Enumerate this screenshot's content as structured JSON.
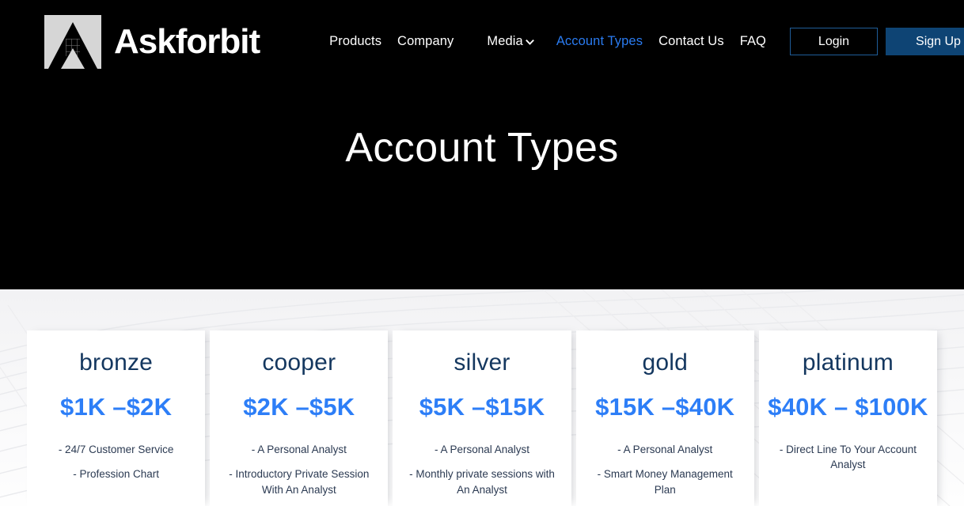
{
  "header": {
    "brand": {
      "name": "Askforbit",
      "logo_icon": "mountain-arrow-logo-icon"
    },
    "nav": [
      {
        "label": "Products",
        "active": false,
        "caret": false
      },
      {
        "label": "Company",
        "active": false,
        "caret": false
      },
      {
        "label": "Media",
        "active": false,
        "caret": true,
        "caret_icon": "chevron-down-icon"
      },
      {
        "label": "Account Types",
        "active": true,
        "caret": false
      },
      {
        "label": "Contact Us",
        "active": false,
        "caret": false
      },
      {
        "label": "FAQ",
        "active": false,
        "caret": false
      }
    ],
    "login_label": "Login",
    "signup_label": "Sign Up"
  },
  "hero": {
    "title": "Account Types"
  },
  "colors": {
    "background_dark": "#000000",
    "background_light": "#fbfbfc",
    "accent_blue": "#2d7ef7",
    "nav_active": "#2a7bf0",
    "signup_button": "#0e4474",
    "login_border": "#1f5d99",
    "card_title": "#14375f",
    "feature_text": "#2b3a52"
  },
  "plans": [
    {
      "name": "bronze",
      "price": "$1K –$2K",
      "features": [
        "- 24/7 Customer Service",
        "- Profession Chart"
      ]
    },
    {
      "name": "cooper",
      "price": "$2K –$5K",
      "features": [
        "- A Personal Analyst",
        "- Introductory Private Session With An Analyst"
      ]
    },
    {
      "name": "silver",
      "price": "$5K –$15K",
      "features": [
        "- A Personal Analyst",
        "- Monthly private sessions with An Analyst"
      ]
    },
    {
      "name": "gold",
      "price": "$15K –$40K",
      "features": [
        "- A Personal Analyst",
        "- Smart Money Management Plan"
      ]
    },
    {
      "name": "platinum",
      "price": "$40K – $100K",
      "features": [
        "- Direct Line To Your Account Analyst"
      ]
    }
  ]
}
